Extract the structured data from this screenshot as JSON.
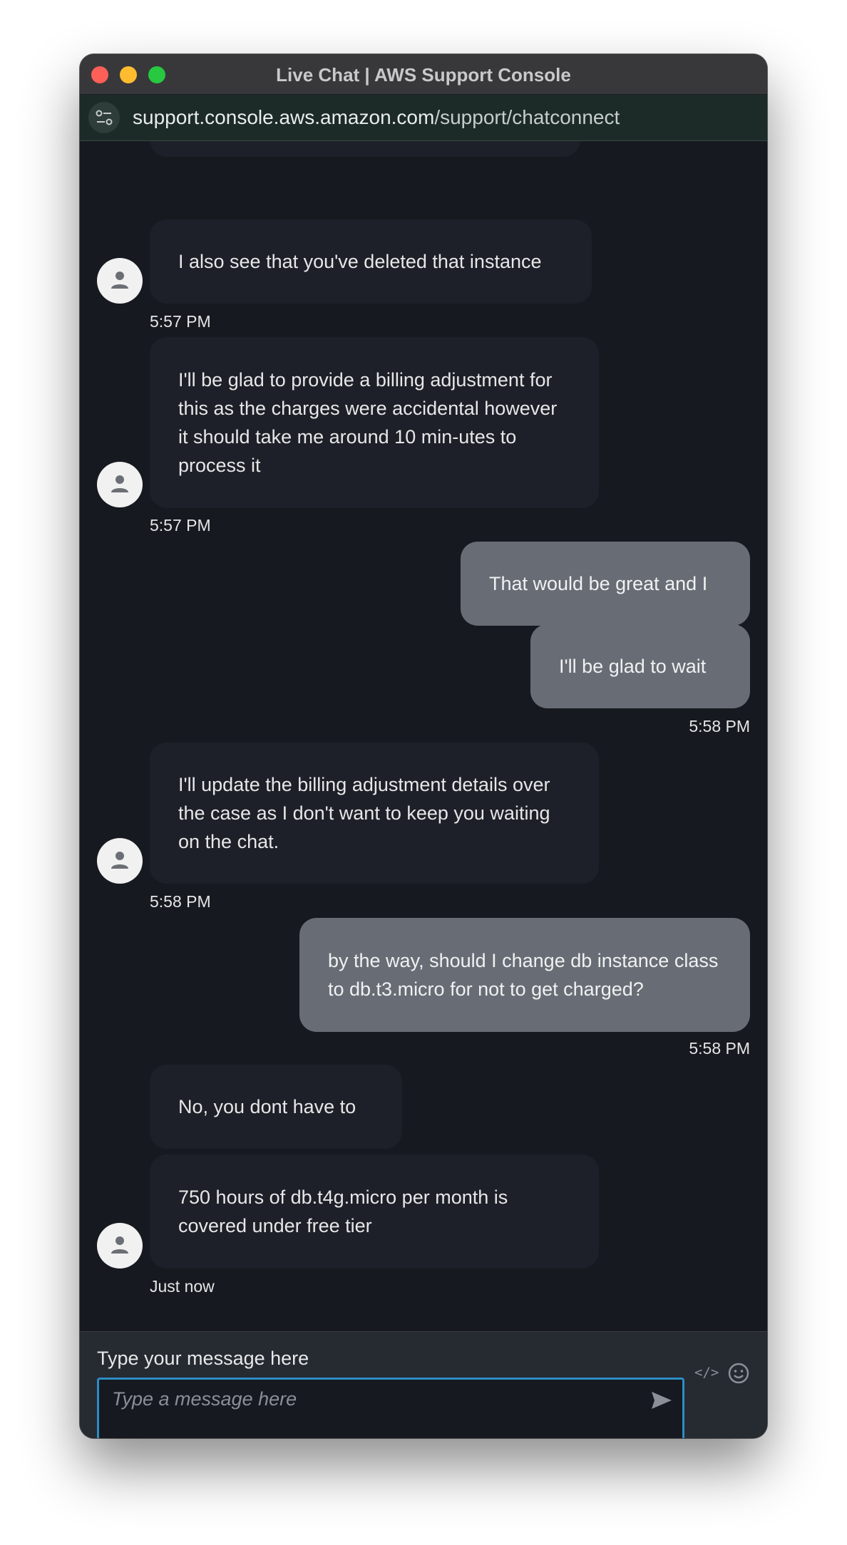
{
  "window": {
    "title": "Live Chat | AWS Support Console"
  },
  "addressbar": {
    "url_host": "support.console.aws.amazon.com",
    "url_path": "/support/chatconnect"
  },
  "messages": [
    {
      "from": "agent",
      "text": "I also see that you've deleted that instance"
    },
    {
      "from": "agent",
      "timestamp": "5:57 PM"
    },
    {
      "from": "agent",
      "text": "I'll be glad to provide a billing adjustment for this as the charges were accidental however it should take me around 10 min-utes to process it"
    },
    {
      "from": "agent",
      "timestamp": "5:57 PM"
    },
    {
      "from": "user",
      "text": "That would be great and I"
    },
    {
      "from": "user",
      "text": "I'll be glad to wait"
    },
    {
      "from": "user",
      "timestamp": "5:58 PM"
    },
    {
      "from": "agent",
      "text": "I'll update the billing adjustment details over the case as I don't want to keep you waiting on the chat."
    },
    {
      "from": "agent",
      "timestamp": "5:58 PM"
    },
    {
      "from": "user",
      "text": "by the way, should I change db instance class to db.t3.micro for not to get charged?"
    },
    {
      "from": "user",
      "timestamp": "5:58 PM"
    },
    {
      "from": "agent",
      "text": "No, you dont have to"
    },
    {
      "from": "agent",
      "text": "750 hours of db.t4g.micro per month is covered under free tier"
    },
    {
      "from": "agent",
      "timestamp": "Just now"
    }
  ],
  "composer": {
    "label": "Type your message here",
    "placeholder": "Type a message here",
    "value": "",
    "send_icon": "send-icon",
    "code_icon": "code-icon",
    "emoji_icon": "emoji-icon"
  },
  "colors": {
    "accent": "#2c8dc6",
    "agent_bubble": "#1d2028",
    "user_bubble": "#686d75",
    "background": "#16191f"
  }
}
